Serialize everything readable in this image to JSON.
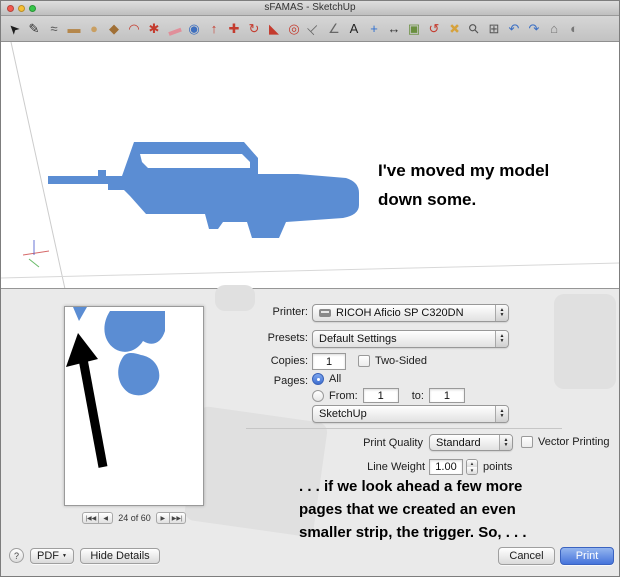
{
  "window": {
    "title": "sFAMAS - SketchUp"
  },
  "glyphs": {
    "up": "▲",
    "down": "▼"
  },
  "toolbar": {
    "icons": [
      {
        "name": "select-tool",
        "glyph": "➤",
        "color": "#1c1c1c",
        "rot": -135
      },
      {
        "name": "line-tool",
        "glyph": "✎",
        "color": "#333333",
        "rot": 0
      },
      {
        "name": "freehand-tool",
        "glyph": "≈",
        "color": "#555555",
        "rot": 0
      },
      {
        "name": "rectangle-tool",
        "glyph": "▬",
        "color": "#b5874b",
        "rot": 0
      },
      {
        "name": "circle-tool",
        "glyph": "●",
        "color": "#c99f62",
        "rot": 0
      },
      {
        "name": "polygon-tool",
        "glyph": "◆",
        "color": "#a06f35",
        "rot": 0
      },
      {
        "name": "arc-tool",
        "glyph": "◠",
        "color": "#c43b2e",
        "rot": 0
      },
      {
        "name": "pie-tool",
        "glyph": "✱",
        "color": "#c43b2e",
        "rot": 0
      },
      {
        "name": "eraser-tool",
        "glyph": "▬",
        "color": "#e08f9a",
        "rot": -20
      },
      {
        "name": "paint-bucket-tool",
        "glyph": "◉",
        "color": "#3e6fbe",
        "rot": 0
      },
      {
        "name": "push-pull-tool",
        "glyph": "↑",
        "color": "#c43b2e",
        "rot": 0
      },
      {
        "name": "move-tool",
        "glyph": "✚",
        "color": "#c43b2e",
        "rot": 0
      },
      {
        "name": "rotate-tool",
        "glyph": "↻",
        "color": "#c43b2e",
        "rot": 0
      },
      {
        "name": "scale-tool",
        "glyph": "◣",
        "color": "#c43b2e",
        "rot": 0
      },
      {
        "name": "offset-tool",
        "glyph": "◎",
        "color": "#c43b2e",
        "rot": 0
      },
      {
        "name": "tape-measure-tool",
        "glyph": "⊢",
        "color": "#666666",
        "rot": -45
      },
      {
        "name": "protractor-tool",
        "glyph": "∠",
        "color": "#666666",
        "rot": 0
      },
      {
        "name": "text-tool",
        "glyph": "A",
        "color": "#222222",
        "rot": 0
      },
      {
        "name": "axes-tool",
        "glyph": "+",
        "color": "#2f6fd0",
        "rot": 0
      },
      {
        "name": "dimension-tool",
        "glyph": "↔",
        "color": "#333333",
        "rot": 0
      },
      {
        "name": "section-plane-tool",
        "glyph": "▣",
        "color": "#6a8f3f",
        "rot": 0
      },
      {
        "name": "orbit-tool",
        "glyph": "↺",
        "color": "#c43b2e",
        "rot": 0
      },
      {
        "name": "pan-tool",
        "glyph": "✚",
        "color": "#d6a23c",
        "rot": 45
      },
      {
        "name": "zoom-tool",
        "glyph": "⚲",
        "color": "#555555",
        "rot": -45
      },
      {
        "name": "zoom-extents-tool",
        "glyph": "⊞",
        "color": "#555555",
        "rot": 0
      },
      {
        "name": "previous-view-tool",
        "glyph": "↶",
        "color": "#3b6fc4",
        "rot": 0
      },
      {
        "name": "next-view-tool",
        "glyph": "↷",
        "color": "#3b6fc4",
        "rot": 0
      },
      {
        "name": "views-tool",
        "glyph": "⌂",
        "color": "#777777",
        "rot": 0
      },
      {
        "name": "model-info-tool",
        "glyph": "◐",
        "color": "#777777",
        "rot": 0
      }
    ]
  },
  "canvas": {
    "annotation": [
      "I've moved my model",
      "down some."
    ]
  },
  "colors": {
    "model_blue": "#5b8dd3",
    "accent_blue": "#4674db"
  },
  "print_dialog": {
    "preview": {
      "page_indicator": "24 of 60",
      "nav": {
        "first": "|◀◀",
        "prev": "◀",
        "next": "▶",
        "last": "▶▶|"
      }
    },
    "fields": {
      "printer_label": "Printer:",
      "printer_value": "RICOH Aficio SP C320DN",
      "presets_label": "Presets:",
      "presets_value": "Default Settings",
      "copies_label": "Copies:",
      "copies_value": "1",
      "two_sided_label": "Two-Sided",
      "pages_label": "Pages:",
      "all_label": "All",
      "from_label": "From:",
      "from_value": "1",
      "to_label": "to:",
      "to_value": "1",
      "app_section_value": "SketchUp",
      "print_quality_label": "Print Quality",
      "print_quality_value": "Standard",
      "vector_printing_label": "Vector Printing",
      "line_weight_label": "Line Weight",
      "line_weight_value": "1.00",
      "points_label": "points"
    },
    "annotation": [
      ". . . if we look ahead a few more",
      "pages that we created an even",
      "smaller strip, the trigger. So, . . ."
    ],
    "footer": {
      "help": "?",
      "pdf": "PDF",
      "hide_details": "Hide Details",
      "cancel": "Cancel",
      "print": "Print"
    }
  }
}
